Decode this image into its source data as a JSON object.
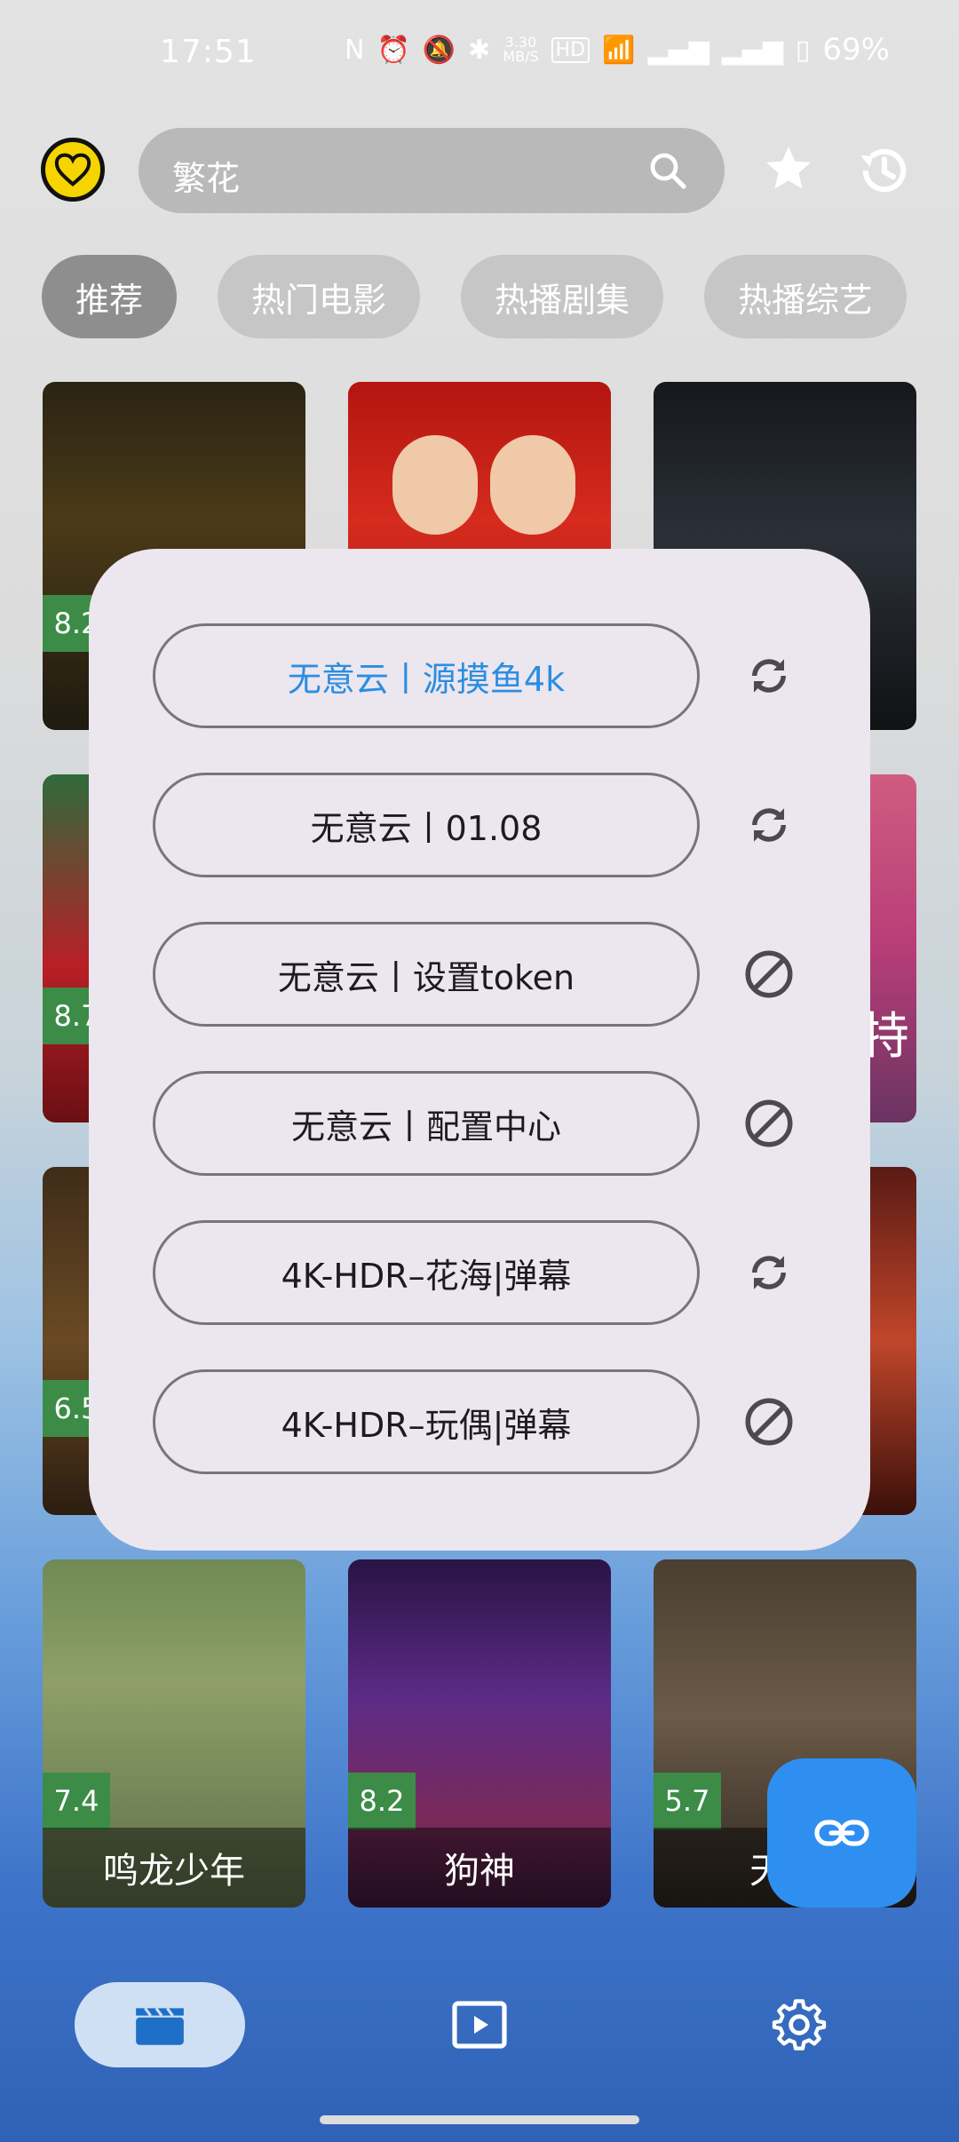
{
  "status_bar": {
    "time": "17:51",
    "net_speed_top": "3.30",
    "net_speed_bottom": "MB/S",
    "hd_badge": "HD",
    "battery": "69%"
  },
  "top_bar": {
    "search_value": "繁花"
  },
  "chips": [
    "推荐",
    "热门电影",
    "热播剧集",
    "热播综艺"
  ],
  "posters": {
    "p1": {
      "rating": "8.2"
    },
    "p4": {
      "rating": "8.7"
    },
    "p6": {
      "text": "特"
    },
    "p7": {
      "rating": "6.5"
    },
    "p10": {
      "rating": "7.4",
      "title": "鸣龙少年"
    },
    "p11": {
      "rating": "8.2",
      "title": "狗神"
    },
    "p12": {
      "rating": "5.7",
      "title": "天启"
    }
  },
  "dialog": {
    "sources": [
      {
        "label": "无意云丨源摸鱼4k",
        "icon": "refresh-icon",
        "selected": true
      },
      {
        "label": "无意云丨01.08",
        "icon": "refresh-icon",
        "selected": false
      },
      {
        "label": "无意云丨设置token",
        "icon": "block-icon",
        "selected": false
      },
      {
        "label": "无意云丨配置中心",
        "icon": "block-icon",
        "selected": false
      },
      {
        "label": "4K-HDR–花海|弹幕",
        "icon": "refresh-icon",
        "selected": false
      },
      {
        "label": "4K-HDR–玩偶|弹幕",
        "icon": "block-icon",
        "selected": false
      }
    ]
  },
  "colors": {
    "accent": "#2f8ff0",
    "selected_text": "#2a8ee0",
    "rating_badge": "#3c8c47",
    "dialog_bg": "#ece6ef"
  }
}
